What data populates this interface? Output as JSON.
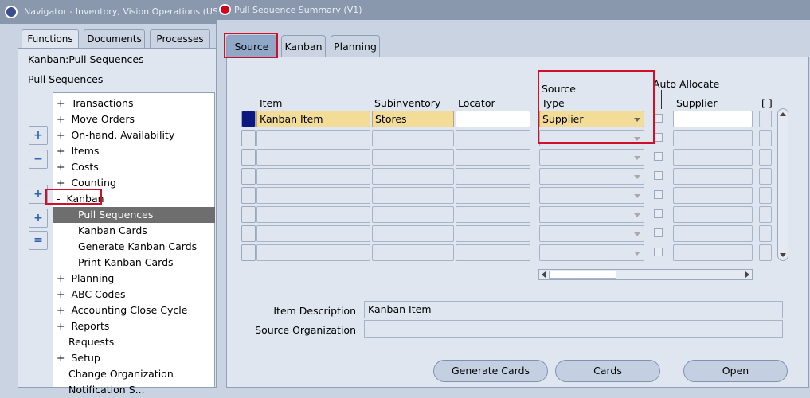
{
  "navigator": {
    "title": "Navigator - Inventory, Vision Operations (US",
    "tabs": [
      "Functions",
      "Documents",
      "Processes"
    ],
    "path_top": "Kanban:Pull Sequences",
    "path_bottom": "Pull Sequences",
    "tree": [
      {
        "prefix": "+",
        "label": "Transactions"
      },
      {
        "prefix": "+",
        "label": "Move Orders"
      },
      {
        "prefix": "+",
        "label": "On-hand, Availability"
      },
      {
        "prefix": "+",
        "label": "Items"
      },
      {
        "prefix": "+",
        "label": "Costs"
      },
      {
        "prefix": "+",
        "label": "Counting"
      },
      {
        "prefix": "-",
        "label": "Kanban"
      },
      {
        "prefix": "",
        "label": "Pull Sequences"
      },
      {
        "prefix": "",
        "label": "Kanban Cards"
      },
      {
        "prefix": "",
        "label": "Generate Kanban Cards"
      },
      {
        "prefix": "",
        "label": "Print Kanban Cards"
      },
      {
        "prefix": "+",
        "label": "Planning"
      },
      {
        "prefix": "+",
        "label": "ABC Codes"
      },
      {
        "prefix": "+",
        "label": "Accounting Close Cycle"
      },
      {
        "prefix": "+",
        "label": "Reports"
      },
      {
        "prefix": "",
        "label": "Requests"
      },
      {
        "prefix": "+",
        "label": "Setup"
      },
      {
        "prefix": "",
        "label": "Change Organization"
      },
      {
        "prefix": "",
        "label": "Notification S..."
      }
    ]
  },
  "form": {
    "title": "Pull Sequence Summary (V1)",
    "tabs": [
      "Source",
      "Kanban",
      "Planning"
    ],
    "headers": {
      "item": "Item",
      "subinventory": "Subinventory",
      "locator": "Locator",
      "source_type_1": "Source",
      "source_type_2": "Type",
      "auto_allocate": "Auto Allocate",
      "supplier": "Supplier",
      "brackets": "[ ]"
    },
    "row1": {
      "item": "Kanban Item",
      "subinventory": "Stores",
      "locator": "",
      "source_type": "Supplier",
      "supplier": ""
    },
    "item_description_label": "Item Description",
    "item_description_value": "Kanban Item",
    "source_org_label": "Source Organization",
    "source_org_value": "",
    "buttons": {
      "generate": "Generate Cards",
      "cards": "Cards",
      "open": "Open"
    }
  },
  "icons": [
    "app-icon",
    "oracle-icon",
    "expand-icon",
    "collapse-icon",
    "expand-all-icon",
    "expand-branch-icon",
    "collapse-all-icon"
  ]
}
